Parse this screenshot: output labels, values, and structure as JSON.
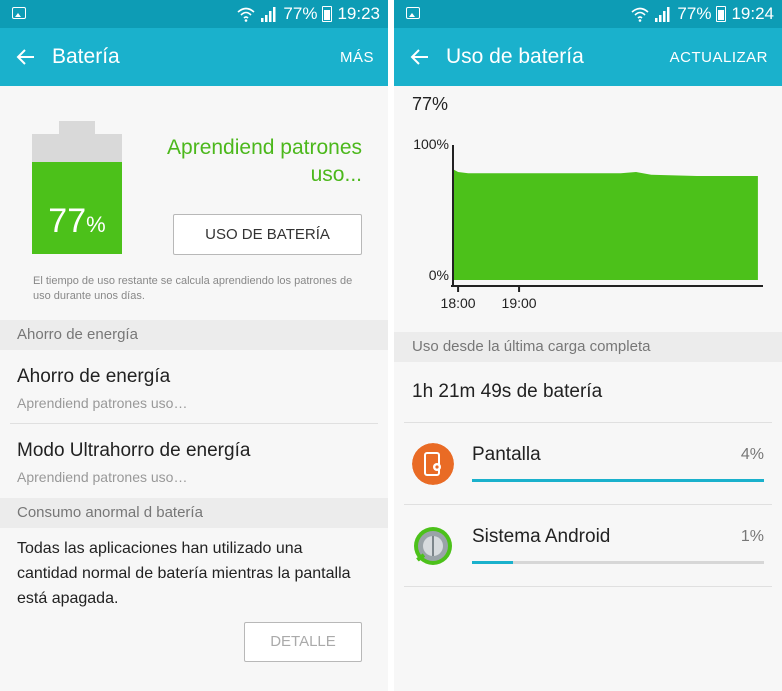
{
  "colors": {
    "status_bar": "#0d9cb5",
    "app_bar": "#1ab1cc",
    "accent_green": "#4cc11a",
    "accent_blue": "#1ab1cc",
    "orange_icon": "#e96b25"
  },
  "left": {
    "status": {
      "battery_text": "77%",
      "time": "19:23"
    },
    "appbar": {
      "title": "Batería",
      "action": "MÁS"
    },
    "battery": {
      "level": 0.77,
      "percent_number": "77",
      "percent_sign": "%"
    },
    "learning_text": "Aprendiend patrones uso...",
    "usage_button": "USO DE BATERÍA",
    "note": "El tiempo de uso restante se calcula aprendiendo los patrones de uso durante unos días.",
    "power_section": {
      "header": "Ahorro de energía",
      "items": [
        {
          "title": "Ahorro de energía",
          "subtitle": "Aprendiend patrones uso…"
        },
        {
          "title": "Modo Ultrahorro de energía",
          "subtitle": "Aprendiend patrones uso…"
        }
      ]
    },
    "abnormal_section": {
      "header": "Consumo anormal d batería",
      "text": "Todas las aplicaciones han utilizado una cantidad normal de batería mientras la pantalla está apagada.",
      "button": "DETALLE"
    }
  },
  "right": {
    "status": {
      "battery_text": "77%",
      "time": "19:24"
    },
    "appbar": {
      "title": "Uso de batería",
      "action": "ACTUALIZAR"
    },
    "current_level": "77%",
    "chart_data": {
      "type": "area",
      "title": "",
      "xlabel": "",
      "ylabel": "",
      "ylim": [
        0,
        100
      ],
      "ytick_labels": [
        "100%",
        "0%"
      ],
      "xtick_labels": [
        "18:00",
        "19:00"
      ],
      "x_minutes": [
        0,
        5,
        15,
        60,
        120,
        165,
        180,
        195,
        240,
        300
      ],
      "x_origin_label": "17:55",
      "x_range_minutes": [
        0,
        305
      ],
      "values": [
        82,
        80,
        79,
        79,
        79,
        79,
        80,
        78,
        77,
        77
      ],
      "color": "#4cc11a",
      "grid": false
    },
    "usage_header": "Uso desde la última carga completa",
    "duration": "1h 21m 49s de batería",
    "apps": [
      {
        "name": "Pantalla",
        "percent": "4%",
        "share": 1.0,
        "icon": "screen-settings-icon"
      },
      {
        "name": "Sistema Android",
        "percent": "1%",
        "share": 0.14,
        "icon": "android-system-icon"
      }
    ]
  }
}
